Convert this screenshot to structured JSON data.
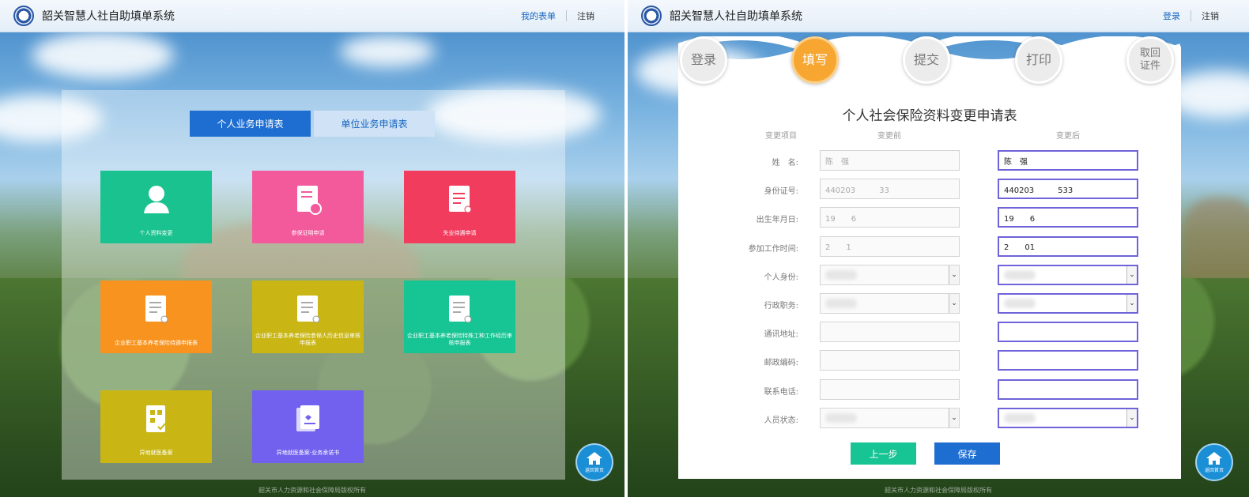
{
  "left": {
    "header": {
      "title": "韶关智慧人社自助填单系统",
      "links": [
        "我的表单",
        "注销"
      ]
    },
    "tabs": [
      "个人业务申请表",
      "单位业务申请表"
    ],
    "tiles": [
      {
        "label": "个人资料变更",
        "color": "#19c28e",
        "icon": "user-icon"
      },
      {
        "label": "参保证明申请",
        "color": "#f25a9c",
        "icon": "certificate-icon"
      },
      {
        "label": "失业待遇申请",
        "color": "#f23c5d",
        "icon": "unemployment-doc-icon"
      },
      {
        "label": "企业职工基本养老保险待遇申报表",
        "color": "#f7931e",
        "icon": "document-icon"
      },
      {
        "label": "企业职工基本养老保险参保人历史信息审核申报表",
        "color": "#c9b614",
        "icon": "document-icon"
      },
      {
        "label": "企业职工基本养老保险特殊工种工作经历审核申报表",
        "color": "#17c493",
        "icon": "document-icon"
      },
      {
        "label": "异地就医备案",
        "color": "#c9b614",
        "icon": "medical-building-icon"
      },
      {
        "label": "异地就医备案-业务承诺书",
        "color": "#7161ee",
        "icon": "commitment-doc-icon"
      }
    ],
    "footer": "韶关市人力资源和社会保障局版权所有",
    "home_label": "返回首页"
  },
  "right": {
    "header": {
      "title": "韶关智慧人社自助填单系统",
      "links": [
        "登录",
        "注销"
      ]
    },
    "steps": [
      "登录",
      "填写",
      "提交",
      "打印",
      "取回\n证件"
    ],
    "active_step": 1,
    "form": {
      "title": "个人社会保险资料变更申请表",
      "col_item": "变更项目",
      "col_before": "变更前",
      "col_after": "变更后",
      "rows": [
        {
          "label": "姓　名:",
          "before": "陈　强",
          "after": "陈　强",
          "type": "text"
        },
        {
          "label": "身份证号:",
          "before": "440203　　　33",
          "after": "440203　　　533",
          "type": "text"
        },
        {
          "label": "出生年月日:",
          "before": "19　　6",
          "after": "19　　6",
          "type": "text"
        },
        {
          "label": "参加工作时间:",
          "before": "2　　1",
          "after": "2　　01",
          "type": "text"
        },
        {
          "label": "个人身份:",
          "before": "",
          "after": "",
          "type": "select"
        },
        {
          "label": "行政职务:",
          "before": "",
          "after": "",
          "type": "select"
        },
        {
          "label": "通讯地址:",
          "before": "",
          "after": "",
          "type": "text"
        },
        {
          "label": "邮政编码:",
          "before": "",
          "after": "",
          "type": "text"
        },
        {
          "label": "联系电话:",
          "before": "",
          "after": "",
          "type": "text"
        },
        {
          "label": "人员状态:",
          "before": "",
          "after": "",
          "type": "select"
        }
      ],
      "buttons": {
        "prev": "上一步",
        "save": "保存"
      }
    },
    "footer": "韶关市人力资源和社会保障局版权所有",
    "home_label": "返回首页"
  }
}
